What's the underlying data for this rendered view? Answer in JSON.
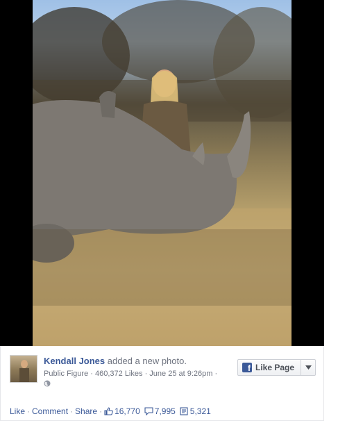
{
  "post": {
    "author_name": "Kendall Jones",
    "action_text": "added a new photo.",
    "category": "Public Figure",
    "likes_text": "460,372 Likes",
    "date": "June 25 at 9:26pm",
    "meta_sep": "·"
  },
  "like_page_button": {
    "label": "Like Page",
    "logo_letter": "f"
  },
  "actions": {
    "like": "Like",
    "comment": "Comment",
    "share": "Share",
    "sep": "·",
    "like_count": "16,770",
    "comment_count": "7,995",
    "share_count": "5,321"
  },
  "colors": {
    "link": "#3b5998",
    "meta": "#6f7480"
  },
  "icons": {
    "globe": "globe-icon",
    "thumb": "thumbs-up-icon",
    "comment": "comment-bubble-icon",
    "share": "share-icon",
    "dropdown": "chevron-down-icon"
  }
}
